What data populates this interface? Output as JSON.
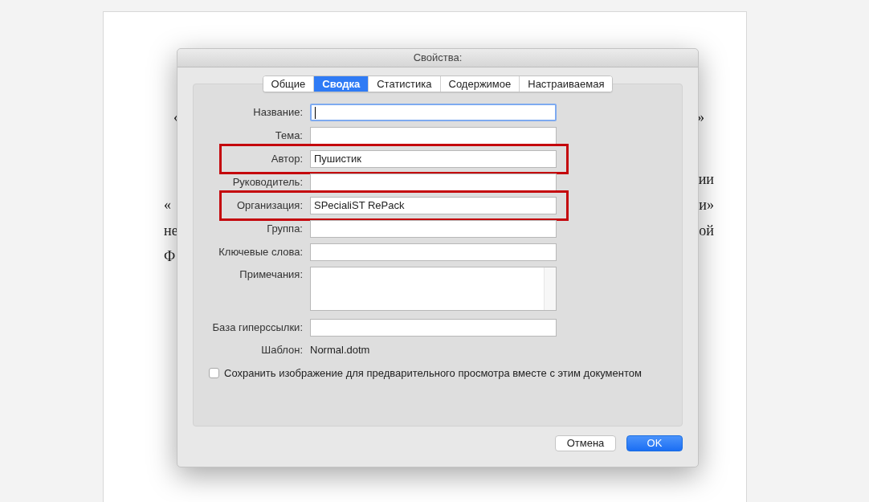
{
  "document": {
    "lines": [
      {
        "left": "«",
        "right": "»"
      },
      {
        "right": "ии"
      },
      {
        "left": "«",
        "right": "и»"
      },
      {
        "left": "не",
        "right": "ой"
      },
      {
        "left": "Ф"
      }
    ]
  },
  "dialog": {
    "title": "Свойства:",
    "tabs": [
      {
        "label": "Общие",
        "selected": false
      },
      {
        "label": "Сводка",
        "selected": true
      },
      {
        "label": "Статистика",
        "selected": false
      },
      {
        "label": "Содержимое",
        "selected": false
      },
      {
        "label": "Настраиваемая",
        "selected": false
      }
    ],
    "fields": [
      {
        "kind": "text",
        "label": "Название:",
        "focused": true,
        "highlighted": false
      },
      {
        "kind": "text",
        "label": "Тема:",
        "focused": false,
        "highlighted": false
      },
      {
        "kind": "text",
        "label": "Автор:",
        "value": "Пушистик",
        "focused": false,
        "highlighted": true
      },
      {
        "kind": "text",
        "label": "Руководитель:",
        "focused": false,
        "highlighted": false
      },
      {
        "kind": "text",
        "label": "Организация:",
        "value": "SPecialiST RePack",
        "focused": false,
        "highlighted": true
      },
      {
        "kind": "text",
        "label": "Группа:",
        "focused": false,
        "highlighted": false
      },
      {
        "kind": "text",
        "label": "Ключевые слова:",
        "focused": false,
        "highlighted": false
      },
      {
        "kind": "textarea",
        "label": "Примечания:",
        "focused": false,
        "highlighted": false
      },
      {
        "kind": "text",
        "label": "База гиперссылки:",
        "focused": false,
        "highlighted": false
      },
      {
        "kind": "static",
        "label": "Шаблон:",
        "value": "Normal.dotm"
      }
    ],
    "checkbox": {
      "label": "Сохранить изображение для предварительного просмотра вместе с этим документом",
      "checked": false
    },
    "buttons": [
      {
        "label": "Отмена",
        "kind": "secondary"
      },
      {
        "label": "OK",
        "kind": "primary"
      }
    ]
  }
}
